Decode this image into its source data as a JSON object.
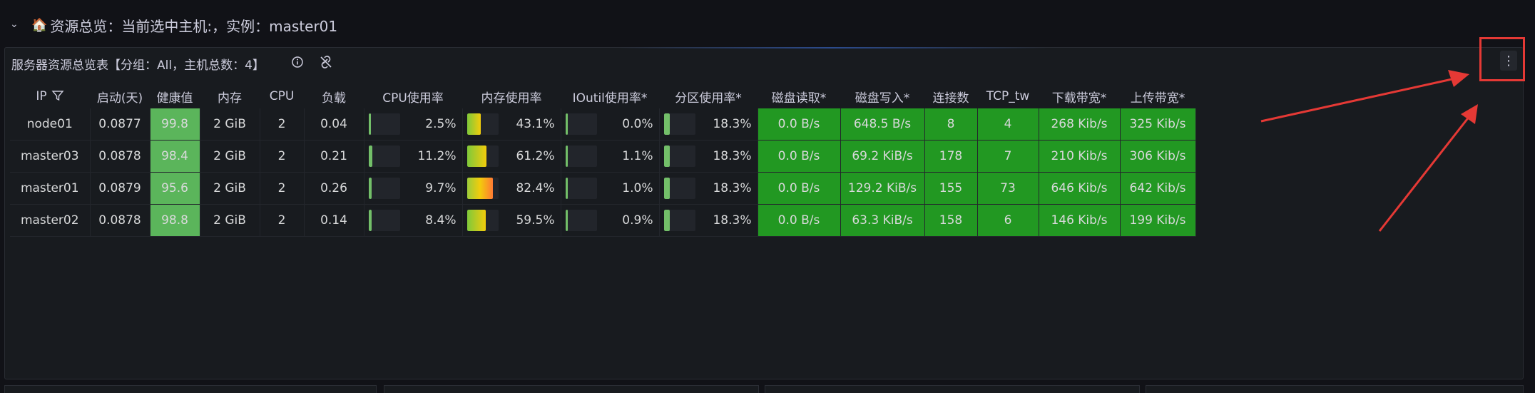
{
  "row": {
    "chevron": "⌄",
    "emoji": "🏠",
    "title": "资源总览：当前选中主机:，实例：master01"
  },
  "panel": {
    "title": "服务器资源总览表【分组：All，主机总数：4】",
    "menu_glyph": "⋮"
  },
  "table": {
    "columns": [
      "IP",
      "启动(天)",
      "健康值",
      "内存",
      "CPU",
      "负载",
      "CPU使用率",
      "内存使用率",
      "IOutil使用率*",
      "分区使用率*",
      "磁盘读取*",
      "磁盘写入*",
      "连接数",
      "TCP_tw",
      "下载带宽*",
      "上传带宽*"
    ],
    "rows": [
      {
        "ip": "node01",
        "uptime": "0.0877",
        "health": "99.8",
        "mem": "2 GiB",
        "cpu": "2",
        "load": "0.04",
        "cpu_pct": "2.5%",
        "cpu_frac": 0.025,
        "mem_pct": "43.1%",
        "mem_frac": 0.431,
        "io_pct": "0.0%",
        "io_frac": 0.0,
        "part_pct": "18.3%",
        "part_frac": 0.183,
        "disk_read": "0.0 B/s",
        "disk_write": "648.5 B/s",
        "conn": "8",
        "tcp_tw": "4",
        "down": "268 Kib/s",
        "up": "325 Kib/s"
      },
      {
        "ip": "master03",
        "uptime": "0.0878",
        "health": "98.4",
        "mem": "2 GiB",
        "cpu": "2",
        "load": "0.21",
        "cpu_pct": "11.2%",
        "cpu_frac": 0.112,
        "mem_pct": "61.2%",
        "mem_frac": 0.612,
        "io_pct": "1.1%",
        "io_frac": 0.011,
        "part_pct": "18.3%",
        "part_frac": 0.183,
        "disk_read": "0.0 B/s",
        "disk_write": "69.2 KiB/s",
        "conn": "178",
        "tcp_tw": "7",
        "down": "210 Kib/s",
        "up": "306 Kib/s"
      },
      {
        "ip": "master01",
        "uptime": "0.0879",
        "health": "95.6",
        "mem": "2 GiB",
        "cpu": "2",
        "load": "0.26",
        "cpu_pct": "9.7%",
        "cpu_frac": 0.097,
        "mem_pct": "82.4%",
        "mem_frac": 0.824,
        "io_pct": "1.0%",
        "io_frac": 0.01,
        "part_pct": "18.3%",
        "part_frac": 0.183,
        "disk_read": "0.0 B/s",
        "disk_write": "129.2 KiB/s",
        "conn": "155",
        "tcp_tw": "73",
        "down": "646 Kib/s",
        "up": "642 Kib/s"
      },
      {
        "ip": "master02",
        "uptime": "0.0878",
        "health": "98.8",
        "mem": "2 GiB",
        "cpu": "2",
        "load": "0.14",
        "cpu_pct": "8.4%",
        "cpu_frac": 0.084,
        "mem_pct": "59.5%",
        "mem_frac": 0.595,
        "io_pct": "0.9%",
        "io_frac": 0.009,
        "part_pct": "18.3%",
        "part_frac": 0.183,
        "disk_read": "0.0 B/s",
        "disk_write": "63.3 KiB/s",
        "conn": "158",
        "tcp_tw": "6",
        "down": "146 Kib/s",
        "up": "199 Kib/s"
      }
    ]
  },
  "colors": {
    "health_bg": "#5bb55b",
    "green_cell": "#229822",
    "link": "#6e9fff",
    "annotation": "#e53935"
  }
}
